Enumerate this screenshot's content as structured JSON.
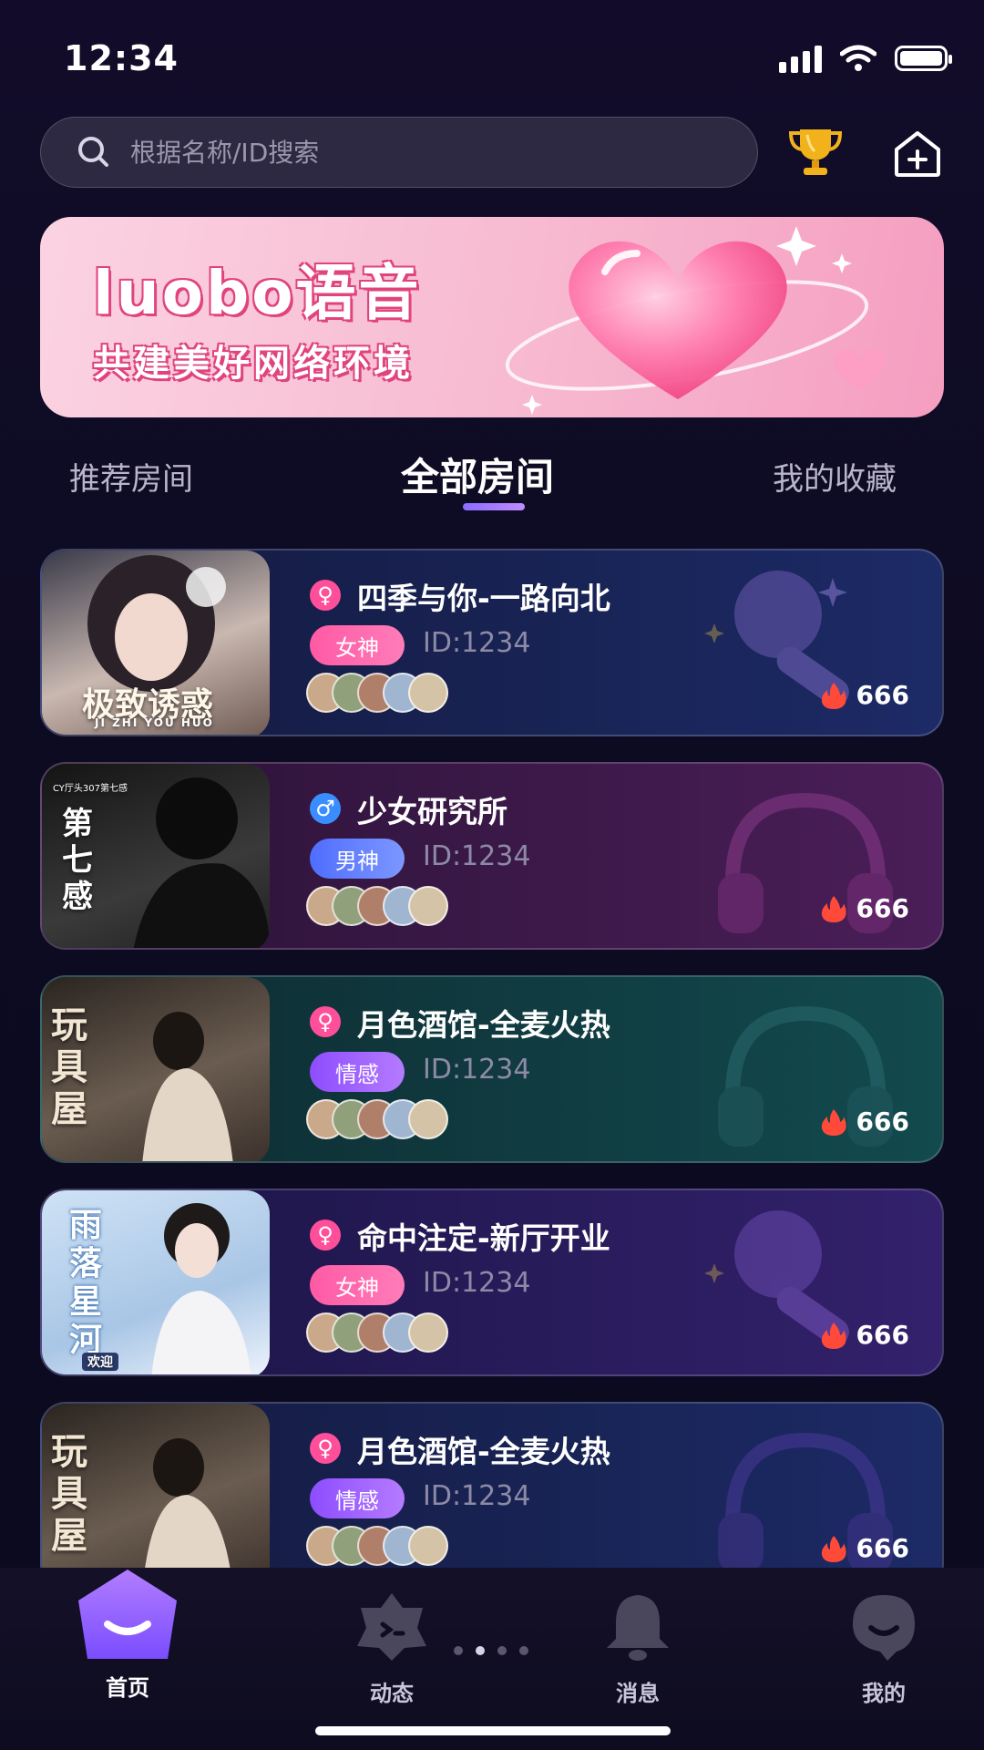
{
  "status_bar": {
    "time": "12:34"
  },
  "search": {
    "placeholder": "根据名称/ID搜索"
  },
  "header": {
    "trophy_icon": "trophy-icon",
    "add_room_icon": "add-room-icon"
  },
  "banner": {
    "title": "luobo语音",
    "subtitle": "共建美好网络环境"
  },
  "tabs": [
    {
      "label": "推荐房间",
      "active": false
    },
    {
      "label": "全部房间",
      "active": true
    },
    {
      "label": "我的收藏",
      "active": false
    }
  ],
  "rooms": [
    {
      "name": "四季与你-一路向北",
      "gender": "female",
      "gender_symbol": "♀",
      "tag": "女神",
      "id": "ID:1234",
      "heat": "666",
      "cover_text": "极致诱惑",
      "cover_sub": "JI ZHI YOU HUO"
    },
    {
      "name": "少女研究所",
      "gender": "male",
      "gender_symbol": "♂",
      "tag": "男神",
      "id": "ID:1234",
      "heat": "666",
      "cover_text": "第七感",
      "cover_sub": "CY厅头307第七感"
    },
    {
      "name": "月色酒馆-全麦火热",
      "gender": "female",
      "gender_symbol": "♀",
      "tag": "情感",
      "id": "ID:1234",
      "heat": "666",
      "cover_text": "玩具屋",
      "cover_sub": ""
    },
    {
      "name": "命中注定-新厅开业",
      "gender": "female",
      "gender_symbol": "♀",
      "tag": "女神",
      "id": "ID:1234",
      "heat": "666",
      "cover_text": "雨落星河",
      "cover_sub": "欢迎"
    },
    {
      "name": "月色酒馆-全麦火热",
      "gender": "female",
      "gender_symbol": "♀",
      "tag": "情感",
      "id": "ID:1234",
      "heat": "666",
      "cover_text": "玩具屋",
      "cover_sub": ""
    }
  ],
  "bottom_nav": [
    {
      "label": "首页",
      "icon": "home-icon",
      "active": true
    },
    {
      "label": "动态",
      "icon": "moments-icon",
      "active": false
    },
    {
      "label": "消息",
      "icon": "bell-icon",
      "active": false
    },
    {
      "label": "我的",
      "icon": "profile-icon",
      "active": false
    }
  ],
  "colors": {
    "female": "#ff4f9a",
    "male": "#3a8dff",
    "tag_female": "#ff5aa5",
    "tag_male": "#5b7cff",
    "tag_emotion": "#9b5cff",
    "accent": "#8a6dff"
  }
}
